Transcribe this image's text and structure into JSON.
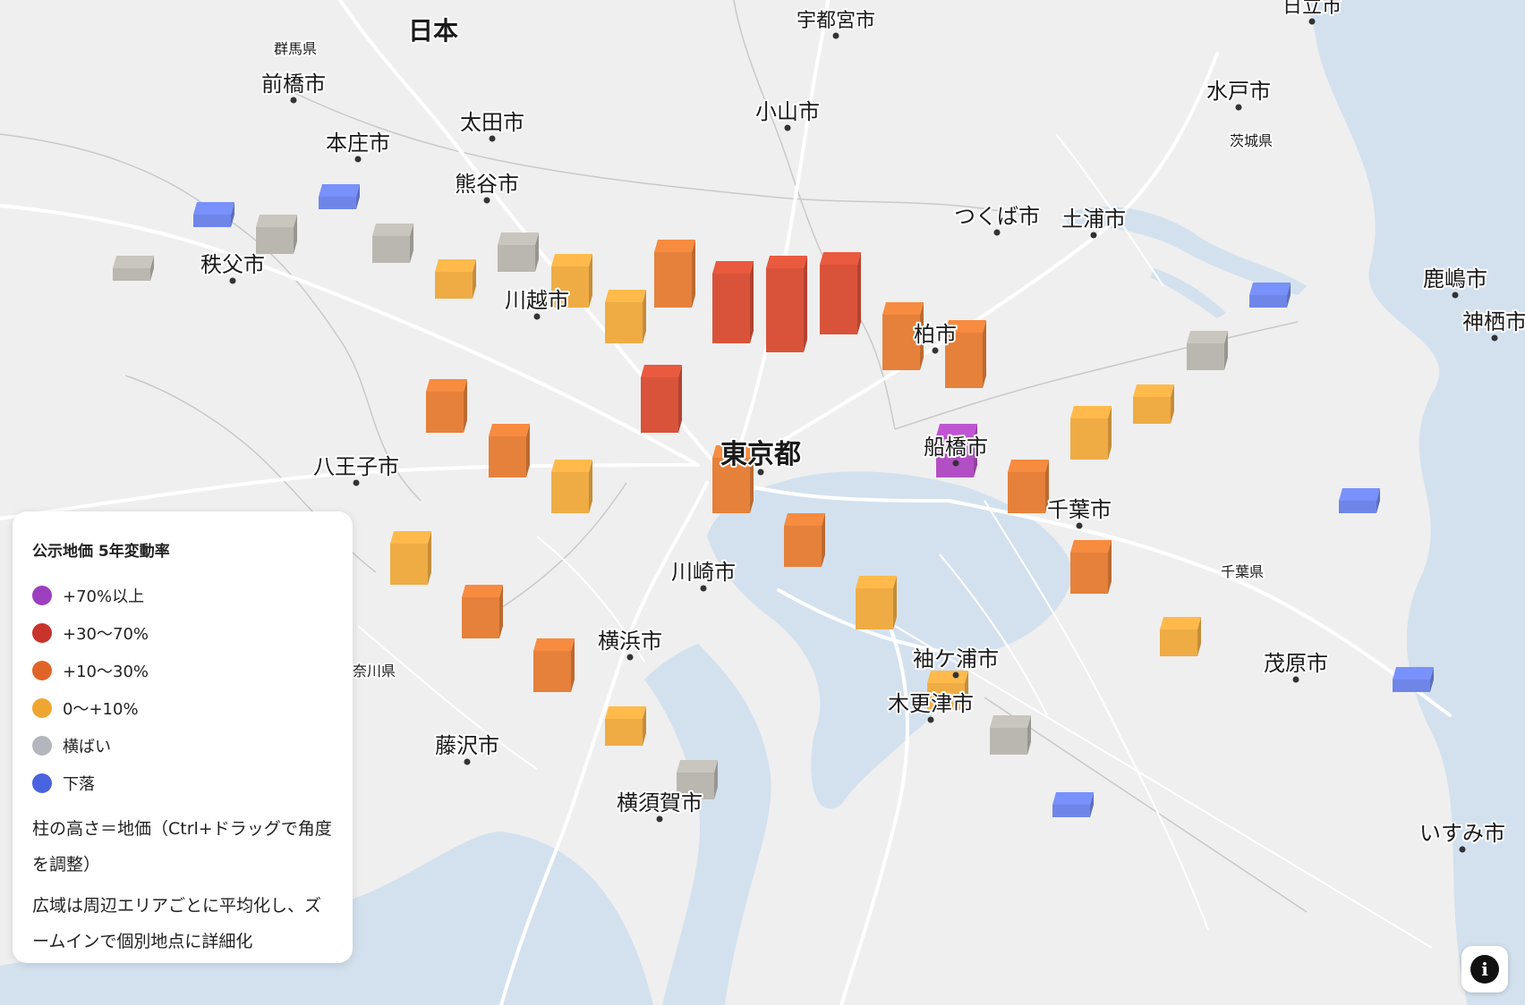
{
  "map": {
    "country_label": "日本",
    "colors": {
      "land": "#efefef",
      "water": "#d3e1ef",
      "road": "#ffffff",
      "boundary": "#c9c9c9"
    },
    "cities": [
      {
        "name": "宇都宮市",
        "kind": "city"
      },
      {
        "name": "日立市",
        "kind": "city"
      },
      {
        "name": "群馬県",
        "kind": "prefecture"
      },
      {
        "name": "前橋市",
        "kind": "city"
      },
      {
        "name": "水戸市",
        "kind": "city"
      },
      {
        "name": "茨城県",
        "kind": "prefecture"
      },
      {
        "name": "太田市",
        "kind": "city"
      },
      {
        "name": "小山市",
        "kind": "city"
      },
      {
        "name": "本庄市",
        "kind": "city"
      },
      {
        "name": "熊谷市",
        "kind": "city"
      },
      {
        "name": "つくば市",
        "kind": "city"
      },
      {
        "name": "土浦市",
        "kind": "city"
      },
      {
        "name": "秩父市",
        "kind": "city"
      },
      {
        "name": "鹿嶋市",
        "kind": "city"
      },
      {
        "name": "神栖市",
        "kind": "city"
      },
      {
        "name": "川越市",
        "kind": "city"
      },
      {
        "name": "柏市",
        "kind": "city"
      },
      {
        "name": "東京都",
        "kind": "capital"
      },
      {
        "name": "船橋市",
        "kind": "city"
      },
      {
        "name": "八王子市",
        "kind": "city"
      },
      {
        "name": "千葉市",
        "kind": "city"
      },
      {
        "name": "千葉県",
        "kind": "prefecture"
      },
      {
        "name": "川崎市",
        "kind": "city"
      },
      {
        "name": "横浜市",
        "kind": "city"
      },
      {
        "name": "袖ケ浦市",
        "kind": "city"
      },
      {
        "name": "茂原市",
        "kind": "city"
      },
      {
        "name": "奈川県",
        "kind": "prefecture"
      },
      {
        "name": "木更津市",
        "kind": "city"
      },
      {
        "name": "藤沢市",
        "kind": "city"
      },
      {
        "name": "横須賀市",
        "kind": "city"
      },
      {
        "name": "いすみ市",
        "kind": "city"
      }
    ],
    "columns": [
      {
        "cls": "flat",
        "h": 0
      },
      {
        "cls": "down",
        "h": 0
      },
      {
        "cls": "flat",
        "h": 1
      },
      {
        "cls": "down",
        "h": 0
      },
      {
        "cls": "flat",
        "h": 1
      },
      {
        "cls": "up0",
        "h": 1
      },
      {
        "cls": "flat",
        "h": 1
      },
      {
        "cls": "up0",
        "h": 2
      },
      {
        "cls": "up0",
        "h": 2
      },
      {
        "cls": "up10",
        "h": 3
      },
      {
        "cls": "up30",
        "h": 4
      },
      {
        "cls": "up30",
        "h": 5
      },
      {
        "cls": "up30",
        "h": 4
      },
      {
        "cls": "up10",
        "h": 3
      },
      {
        "cls": "up10",
        "h": 3
      },
      {
        "cls": "plus70",
        "h": 2
      },
      {
        "cls": "up10",
        "h": 2
      },
      {
        "cls": "up0",
        "h": 2
      },
      {
        "cls": "up0",
        "h": 1
      },
      {
        "cls": "flat",
        "h": 1
      },
      {
        "cls": "down",
        "h": 0
      },
      {
        "cls": "up10",
        "h": 2
      },
      {
        "cls": "up10",
        "h": 2
      },
      {
        "cls": "up0",
        "h": 2
      },
      {
        "cls": "up30",
        "h": 3
      },
      {
        "cls": "up10",
        "h": 3
      },
      {
        "cls": "up10",
        "h": 2
      },
      {
        "cls": "up0",
        "h": 2
      },
      {
        "cls": "up0",
        "h": 1
      },
      {
        "cls": "flat",
        "h": 1
      },
      {
        "cls": "down",
        "h": 0
      },
      {
        "cls": "up0",
        "h": 2
      },
      {
        "cls": "up10",
        "h": 2
      },
      {
        "cls": "up10",
        "h": 2
      },
      {
        "cls": "up0",
        "h": 1
      },
      {
        "cls": "flat",
        "h": 1
      },
      {
        "cls": "down",
        "h": 0
      },
      {
        "cls": "down",
        "h": 0
      },
      {
        "cls": "up10",
        "h": 2
      },
      {
        "cls": "up0",
        "h": 1
      }
    ]
  },
  "legend": {
    "title": "公示地価 5年変動率",
    "items": [
      {
        "label": "+70%以上",
        "color": "#9b3fbf"
      },
      {
        "label": "+30〜70%",
        "color": "#c8342c"
      },
      {
        "label": "+10〜30%",
        "color": "#e06428"
      },
      {
        "label": "0〜+10%",
        "color": "#efa631"
      },
      {
        "label": "横ばい",
        "color": "#b3b6bc"
      },
      {
        "label": "下落",
        "color": "#4a63e0"
      }
    ],
    "note1": "柱の高さ＝地価（Ctrl+ドラッグで角度を調整）",
    "note2": "広域は周辺エリアごとに平均化し、ズームインで個別地点に詳細化"
  },
  "info_button": {
    "icon": "info-icon",
    "glyph": "i"
  }
}
